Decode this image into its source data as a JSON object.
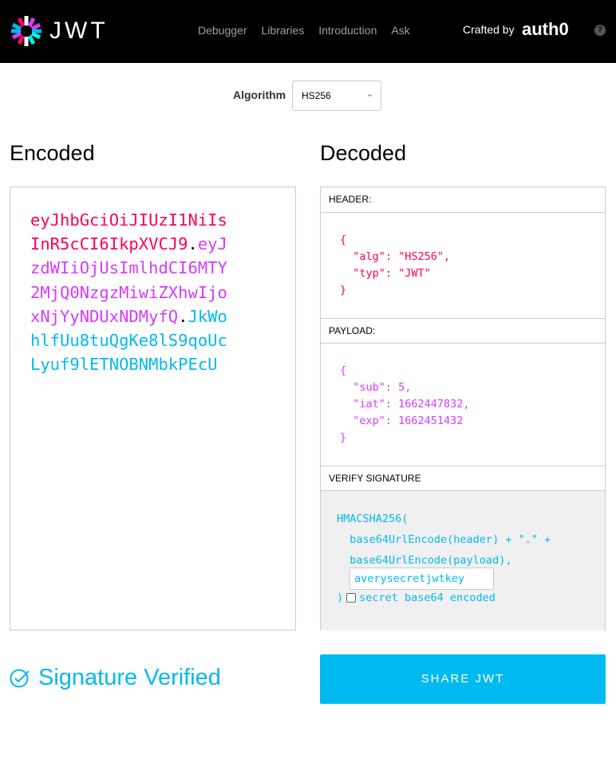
{
  "nav": {
    "logo_text": "JWT",
    "links": [
      "Debugger",
      "Libraries",
      "Introduction",
      "Ask"
    ],
    "crafted_by": "Crafted by",
    "brand": "auth0",
    "help": "?"
  },
  "algorithm": {
    "label": "Algorithm",
    "value": "HS256"
  },
  "encoded": {
    "title": "Encoded",
    "header": "eyJhbGciOiJIUzI1NiIsInR5cCI6IkpXVCJ9",
    "payload": "eyJzdWIiOjUsImlhdCI6MTY2MjQ0NzgzMiwiZXhwIjoxNjYyNDUxNDMyfQ",
    "signature": "JkWohlfUu8tuQgKe8lS9qoUcLyuf9lETNOBNMbkPEcU",
    "dot": "."
  },
  "decoded": {
    "title": "Decoded",
    "header_label": "HEADER:",
    "header_json": "{\n  \"alg\": \"HS256\",\n  \"typ\": \"JWT\"\n}",
    "payload_label": "PAYLOAD:",
    "payload_json": "{\n  \"sub\": 5,\n  \"iat\": 1662447832,\n  \"exp\": 1662451432\n}",
    "verify_label": "VERIFY SIGNATURE",
    "verify_code": "HMACSHA256(\n  base64UrlEncode(header) + \".\" +\n  base64UrlEncode(payload),",
    "secret_value": "averysecretjwtkey",
    "close_paren": ")",
    "checkbox_label": "secret base64 encoded"
  },
  "status": {
    "text": "Signature Verified"
  },
  "share_label": "SHARE JWT",
  "colors": {
    "header": "#fb015b",
    "payload": "#d63aff",
    "signature": "#00b9f1"
  }
}
